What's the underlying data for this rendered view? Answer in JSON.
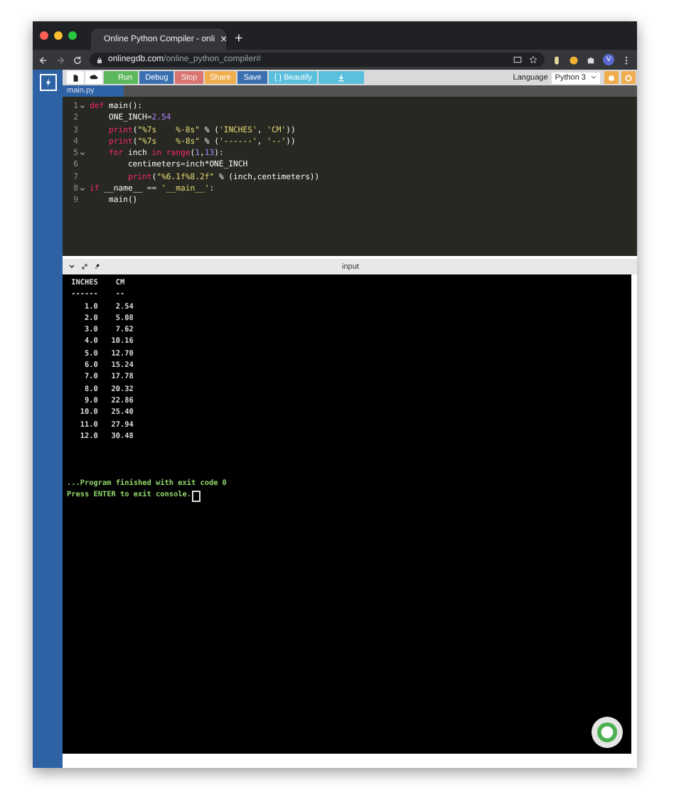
{
  "browser": {
    "tab": {
      "title": "Online Python Compiler - onli",
      "close": "×"
    },
    "new_tab": "+",
    "address": {
      "host": "onlinegdb.com",
      "path": "/online_python_compiler#"
    },
    "profile": "V"
  },
  "toolbar": {
    "buttons": [
      {
        "label": "Run",
        "kind": "run"
      },
      {
        "label": "Debug",
        "kind": "debug"
      },
      {
        "label": "Stop",
        "kind": "stop"
      },
      {
        "label": "Share",
        "kind": "share"
      },
      {
        "label": "Save",
        "kind": "save"
      },
      {
        "label": "{ } Beautify",
        "kind": "beautify"
      }
    ],
    "language_label": "Language",
    "language": "Python 3"
  },
  "file_tab": "main.py",
  "code": [
    {
      "number": "1",
      "fold": true,
      "tokens": [
        {
          "text": "def",
          "kind": "keyword"
        },
        {
          "text": " main():",
          "kind": "plain"
        }
      ]
    },
    {
      "number": "2",
      "fold": false,
      "tokens": [
        {
          "text": "    ONE_INCH=",
          "kind": "plain"
        },
        {
          "text": "2.54",
          "kind": "number"
        }
      ]
    },
    {
      "number": "3",
      "fold": false,
      "tokens": [
        {
          "text": "    print",
          "kind": "builtin"
        },
        {
          "text": "(",
          "kind": "plain"
        },
        {
          "text": "\"%7s    %-8s\"",
          "kind": "string"
        },
        {
          "text": " % (",
          "kind": "plain"
        },
        {
          "text": "'INCHES'",
          "kind": "string"
        },
        {
          "text": ", ",
          "kind": "plain"
        },
        {
          "text": "'CM'",
          "kind": "string"
        },
        {
          "text": "))",
          "kind": "plain"
        }
      ]
    },
    {
      "number": "4",
      "fold": false,
      "tokens": [
        {
          "text": "    print",
          "kind": "builtin"
        },
        {
          "text": "(",
          "kind": "plain"
        },
        {
          "text": "\"%7s    %-8s\"",
          "kind": "string"
        },
        {
          "text": " % (",
          "kind": "plain"
        },
        {
          "text": "'------'",
          "kind": "string"
        },
        {
          "text": ", ",
          "kind": "plain"
        },
        {
          "text": "'--'",
          "kind": "string"
        },
        {
          "text": "))",
          "kind": "plain"
        }
      ]
    },
    {
      "number": "5",
      "fold": true,
      "tokens": [
        {
          "text": "    for",
          "kind": "keyword"
        },
        {
          "text": " inch ",
          "kind": "plain"
        },
        {
          "text": "in",
          "kind": "keyword"
        },
        {
          "text": " range",
          "kind": "builtin"
        },
        {
          "text": "(",
          "kind": "plain"
        },
        {
          "text": "1",
          "kind": "number"
        },
        {
          "text": ",",
          "kind": "plain"
        },
        {
          "text": "13",
          "kind": "number"
        },
        {
          "text": "):",
          "kind": "plain"
        }
      ]
    },
    {
      "number": "6",
      "fold": false,
      "tokens": [
        {
          "text": "        centimeters=inch*ONE_INCH",
          "kind": "plain"
        }
      ]
    },
    {
      "number": "7",
      "fold": false,
      "tokens": [
        {
          "text": "        print",
          "kind": "builtin"
        },
        {
          "text": "(",
          "kind": "plain"
        },
        {
          "text": "\"%6.1f%8.2f\"",
          "kind": "string"
        },
        {
          "text": " % (inch,centimeters))",
          "kind": "plain"
        }
      ]
    },
    {
      "number": "8",
      "fold": true,
      "tokens": [
        {
          "text": "if",
          "kind": "keyword"
        },
        {
          "text": " __name__ == ",
          "kind": "plain"
        },
        {
          "text": "'__main__'",
          "kind": "string"
        },
        {
          "text": ":",
          "kind": "plain"
        }
      ]
    },
    {
      "number": "9",
      "fold": false,
      "tokens": [
        {
          "text": "    main()",
          "kind": "plain"
        }
      ]
    }
  ],
  "console_header": "input",
  "console": [
    {
      "text": " INCHES    CM",
      "kind": "output"
    },
    {
      "text": " ------    --",
      "kind": "output"
    },
    {
      "text": "    1.0    2.54",
      "kind": "output"
    },
    {
      "text": "    2.0    5.08",
      "kind": "output"
    },
    {
      "text": "    3.0    7.62",
      "kind": "output"
    },
    {
      "text": "    4.0   10.16",
      "kind": "output"
    },
    {
      "text": "    5.0   12.70",
      "kind": "output"
    },
    {
      "text": "    6.0   15.24",
      "kind": "output"
    },
    {
      "text": "    7.0   17.78",
      "kind": "output"
    },
    {
      "text": "    8.0   20.32",
      "kind": "output"
    },
    {
      "text": "    9.0   22.86",
      "kind": "output"
    },
    {
      "text": "   10.0   25.40",
      "kind": "output"
    },
    {
      "text": "   11.0   27.94",
      "kind": "output"
    },
    {
      "text": "   12.0   30.48",
      "kind": "output"
    },
    {
      "text": "...Program finished with exit code 0",
      "kind": "status"
    },
    {
      "text": "Press ENTER to exit console.",
      "kind": "prompt"
    }
  ]
}
